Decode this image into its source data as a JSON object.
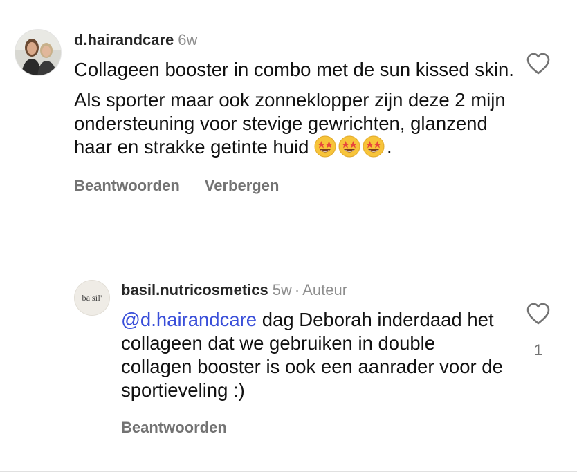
{
  "comments": [
    {
      "username": "d.hairandcare",
      "age": "6w",
      "paragraphs": [
        "Collageen booster in combo met de sun kissed skin.",
        "Als sporter maar ook zonneklopper zijn deze 2 mijn ondersteuning voor stevige gewrichten, glanzend haar en strakke getinte huid"
      ],
      "trailing": ".",
      "emoji": "star-struck-icon",
      "actions": {
        "reply": "Beantwoorden",
        "hide": "Verbergen"
      }
    },
    {
      "username": "basil.nutricosmetics",
      "age": "5w",
      "separator": "·",
      "badge": "Auteur",
      "mention": "@d.hairandcare",
      "text": " dag Deborah inderdaad het collageen dat we gebruiken in double collagen booster is ook een aanrader voor de sportieveling :)",
      "avatar_logo": "ba'sil'",
      "like_count": "1",
      "actions": {
        "reply": "Beantwoorden"
      }
    }
  ],
  "colors": {
    "username": "#262626",
    "meta": "#8e8e8e",
    "action": "#737373",
    "mention": "#3a4fd9"
  },
  "icons": [
    "heart-outline-icon",
    "star-struck-icon"
  ]
}
